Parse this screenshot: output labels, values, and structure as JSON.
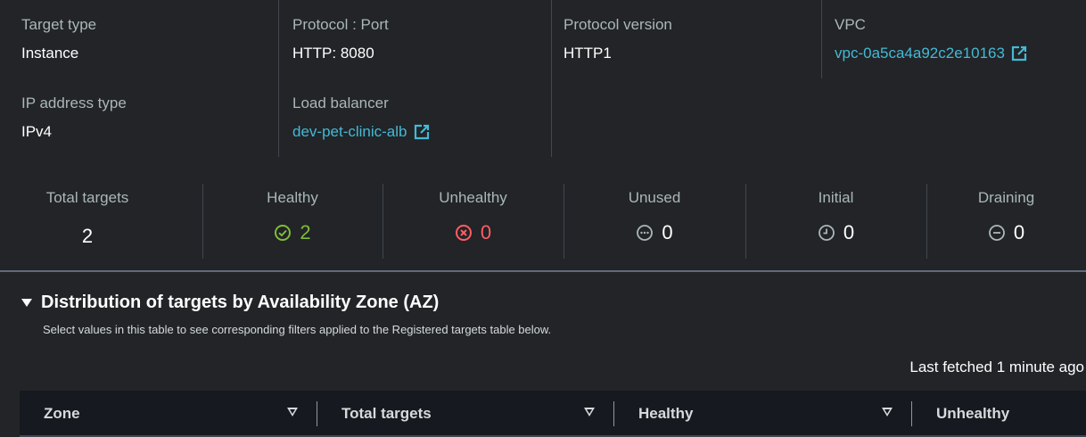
{
  "details": {
    "target_type_label": "Target type",
    "target_type_value": "Instance",
    "ip_address_type_label": "IP address type",
    "ip_address_type_value": "IPv4",
    "protocol_port_label": "Protocol : Port",
    "protocol_port_value": "HTTP: 8080",
    "load_balancer_label": "Load balancer",
    "load_balancer_value": "dev-pet-clinic-alb",
    "protocol_version_label": "Protocol version",
    "protocol_version_value": "HTTP1",
    "vpc_label": "VPC",
    "vpc_value": "vpc-0a5ca4a92c2e10163"
  },
  "counts": {
    "total": {
      "label": "Total targets",
      "value": "2"
    },
    "healthy": {
      "label": "Healthy",
      "value": "2",
      "icon": "check-circle-icon",
      "color": "#7fbd36"
    },
    "unhealthy": {
      "label": "Unhealthy",
      "value": "0",
      "icon": "x-circle-icon",
      "color": "#ff5d64"
    },
    "unused": {
      "label": "Unused",
      "value": "0",
      "icon": "ellipsis-circle-icon"
    },
    "initial": {
      "label": "Initial",
      "value": "0",
      "icon": "clock-circle-icon"
    },
    "draining": {
      "label": "Draining",
      "value": "0",
      "icon": "minus-circle-icon"
    }
  },
  "az": {
    "title": "Distribution of targets by Availability Zone (AZ)",
    "description": "Select values in this table to see corresponding filters applied to the Registered targets table below.",
    "last_fetched": "Last fetched 1 minute ago",
    "columns": [
      "Zone",
      "Total targets",
      "Healthy",
      "Unhealthy"
    ]
  },
  "colors": {
    "link": "#44b9d6",
    "background": "#222427",
    "table_header": "#16191f"
  }
}
